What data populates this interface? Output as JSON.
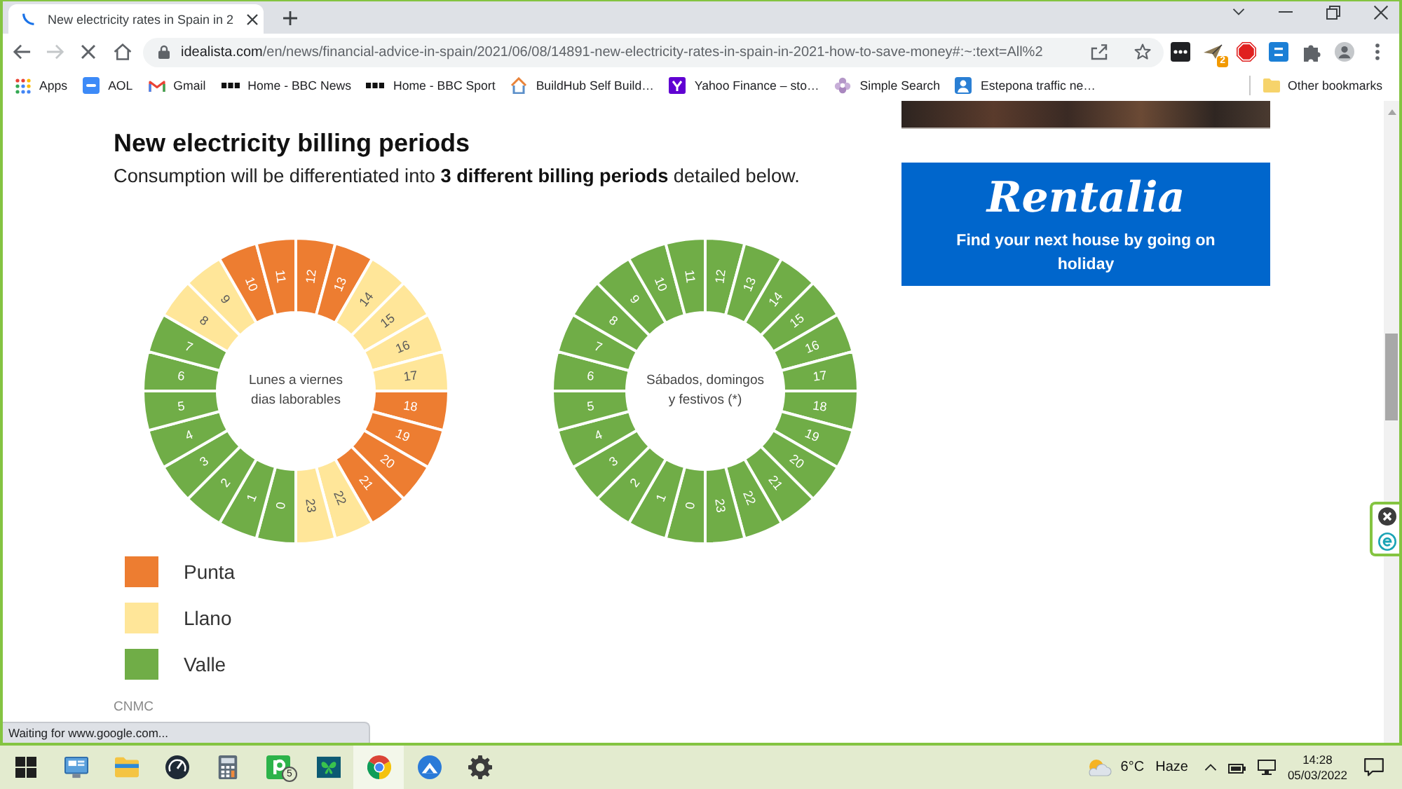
{
  "browser": {
    "tab": {
      "title": "New electricity rates in Spain in 2",
      "loading": true
    },
    "navigation": {
      "forward_disabled": true
    },
    "address": {
      "host": "idealista.com",
      "path": "/en/news/financial-advice-in-spain/2021/06/08/14891-new-electricity-rates-in-spain-in-2021-how-to-save-money#:~:text=All%2"
    },
    "extensions": [
      {
        "kind": "dots"
      },
      {
        "kind": "plane",
        "badge": "2"
      },
      {
        "kind": "stop"
      },
      {
        "kind": "tile"
      },
      {
        "kind": "puzzle"
      }
    ],
    "bookmarks": [
      {
        "label": "Apps",
        "kind": "grid"
      },
      {
        "label": "AOL",
        "kind": "tile"
      },
      {
        "label": "Gmail",
        "kind": "mail"
      },
      {
        "label": "Home - BBC News",
        "kind": "squares"
      },
      {
        "label": "Home - BBC Sport",
        "kind": "squares"
      },
      {
        "label": "BuildHub Self Build…",
        "kind": "house"
      },
      {
        "label": "Yahoo Finance – sto…",
        "kind": "ymark"
      },
      {
        "label": "Simple Search",
        "kind": "flower"
      },
      {
        "label": "Estepona traffic ne…",
        "kind": "person"
      }
    ],
    "other_bookmarks": "Other bookmarks",
    "status": "Waiting for www.google.com..."
  },
  "article": {
    "heading": "New electricity billing periods",
    "intro": "Consumption will be differentiated into **3 different billing periods** detailed below.",
    "figure": {
      "dials": [
        {
          "caption": "Lunes a viernes dias laborables",
          "hours": [
            {
              "label": "0",
              "color": "#70ad47"
            },
            {
              "label": "1",
              "color": "#70ad47"
            },
            {
              "label": "2",
              "color": "#70ad47"
            },
            {
              "label": "3",
              "color": "#70ad47"
            },
            {
              "label": "4",
              "color": "#70ad47"
            },
            {
              "label": "5",
              "color": "#70ad47"
            },
            {
              "label": "6",
              "color": "#70ad47"
            },
            {
              "label": "7",
              "color": "#70ad47"
            },
            {
              "label": "8",
              "color": "#ffe699"
            },
            {
              "label": "9",
              "color": "#ffe699"
            },
            {
              "label": "10",
              "color": "#ed7d31"
            },
            {
              "label": "11",
              "color": "#ed7d31"
            },
            {
              "label": "12",
              "color": "#ed7d31"
            },
            {
              "label": "13",
              "color": "#ed7d31"
            },
            {
              "label": "14",
              "color": "#ffe699"
            },
            {
              "label": "15",
              "color": "#ffe699"
            },
            {
              "label": "16",
              "color": "#ffe699"
            },
            {
              "label": "17",
              "color": "#ffe699"
            },
            {
              "label": "18",
              "color": "#ed7d31"
            },
            {
              "label": "19",
              "color": "#ed7d31"
            },
            {
              "label": "20",
              "color": "#ed7d31"
            },
            {
              "label": "21",
              "color": "#ed7d31"
            },
            {
              "label": "22",
              "color": "#ffe699"
            },
            {
              "label": "23",
              "color": "#ffe699"
            }
          ]
        },
        {
          "caption": "Sábados, domingos y festivos (*)",
          "hours": [
            {
              "label": "0",
              "color": "#70ad47"
            },
            {
              "label": "1",
              "color": "#70ad47"
            },
            {
              "label": "2",
              "color": "#70ad47"
            },
            {
              "label": "3",
              "color": "#70ad47"
            },
            {
              "label": "4",
              "color": "#70ad47"
            },
            {
              "label": "5",
              "color": "#70ad47"
            },
            {
              "label": "6",
              "color": "#70ad47"
            },
            {
              "label": "7",
              "color": "#70ad47"
            },
            {
              "label": "8",
              "color": "#70ad47"
            },
            {
              "label": "9",
              "color": "#70ad47"
            },
            {
              "label": "10",
              "color": "#70ad47"
            },
            {
              "label": "11",
              "color": "#70ad47"
            },
            {
              "label": "12",
              "color": "#70ad47"
            },
            {
              "label": "13",
              "color": "#70ad47"
            },
            {
              "label": "14",
              "color": "#70ad47"
            },
            {
              "label": "15",
              "color": "#70ad47"
            },
            {
              "label": "16",
              "color": "#70ad47"
            },
            {
              "label": "17",
              "color": "#70ad47"
            },
            {
              "label": "18",
              "color": "#70ad47"
            },
            {
              "label": "19",
              "color": "#70ad47"
            },
            {
              "label": "20",
              "color": "#70ad47"
            },
            {
              "label": "21",
              "color": "#70ad47"
            },
            {
              "label": "22",
              "color": "#70ad47"
            },
            {
              "label": "23",
              "color": "#70ad47"
            }
          ]
        }
      ],
      "legend": [
        {
          "label": "Punta",
          "color": "#ed7d31"
        },
        {
          "label": "Llano",
          "color": "#ffe699"
        },
        {
          "label": "Valle",
          "color": "#70ad47"
        }
      ],
      "source": "CNMC"
    }
  },
  "sidebar": {
    "ad": {
      "brand": "Rentalia",
      "text": "Find your next house by going on holiday"
    }
  },
  "taskbar": {
    "apps": [
      {
        "kind": "monitor",
        "selected": false
      },
      {
        "kind": "folder",
        "selected": false
      },
      {
        "kind": "gauge",
        "selected": false
      },
      {
        "kind": "calculator",
        "selected": false
      },
      {
        "kind": "ptile",
        "badge": "5",
        "selected": false
      },
      {
        "kind": "butterfly",
        "selected": false
      },
      {
        "kind": "chrome",
        "selected": true
      },
      {
        "kind": "mountain",
        "selected": false
      },
      {
        "kind": "gear",
        "selected": false
      }
    ],
    "weather": {
      "temperature": "6°C",
      "condition": "Haze"
    },
    "time": "14:28",
    "date": "05/03/2022"
  }
}
